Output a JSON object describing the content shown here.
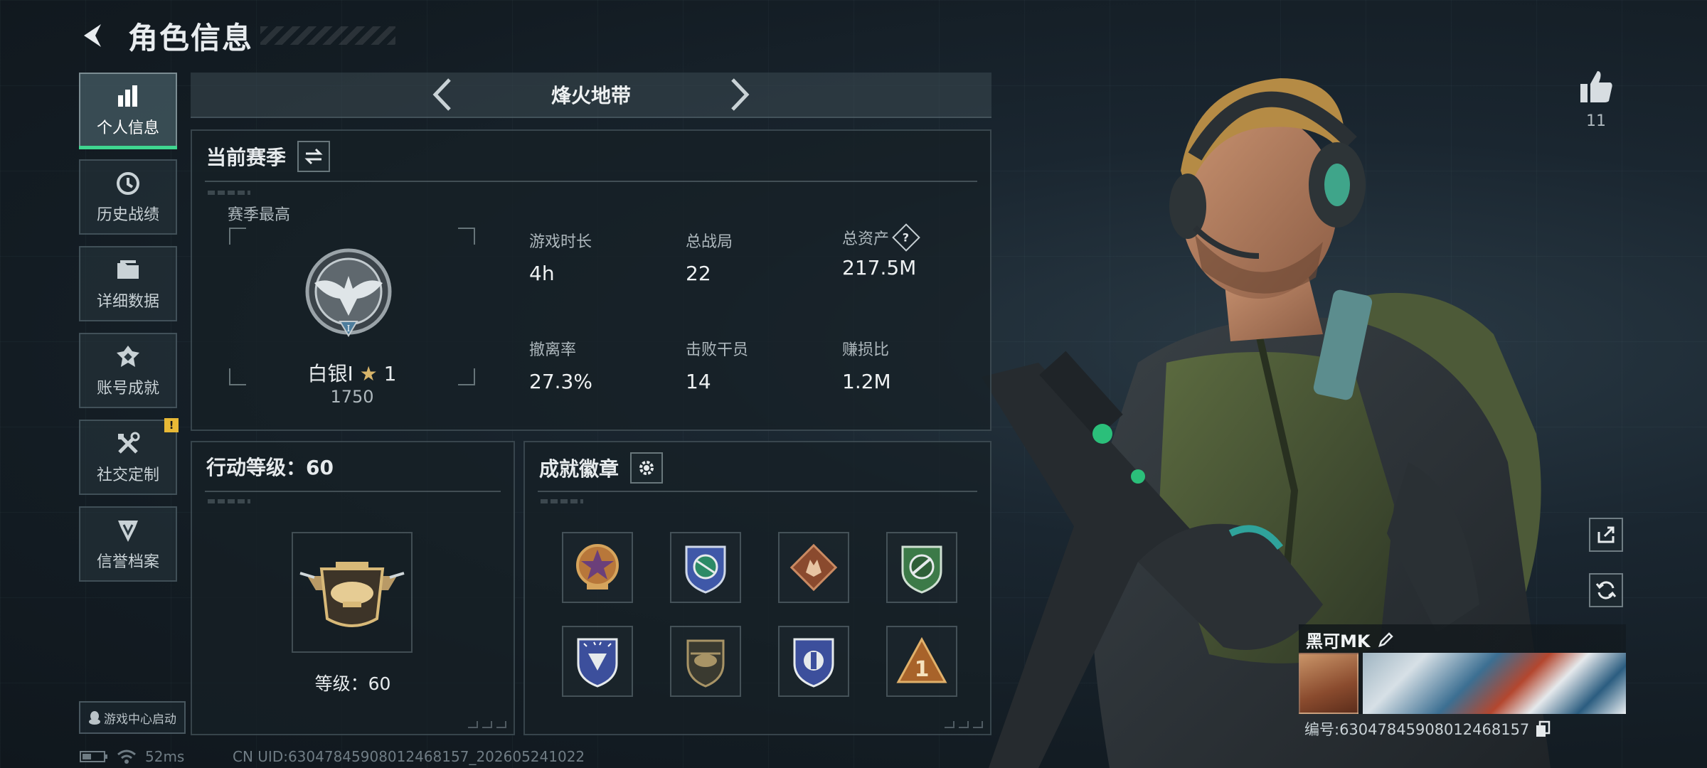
{
  "header": {
    "title": "角色信息"
  },
  "sidebar": {
    "items": [
      {
        "label": "个人信息",
        "icon": "bar-chart-icon",
        "active": true
      },
      {
        "label": "历史战绩",
        "icon": "history-clock-icon"
      },
      {
        "label": "详细数据",
        "icon": "folder-icon"
      },
      {
        "label": "账号成就",
        "icon": "achievement-icon"
      },
      {
        "label": "社交定制",
        "icon": "tools-icon",
        "badge": "!"
      },
      {
        "label": "信誉档案",
        "icon": "reputation-icon"
      }
    ]
  },
  "launch": {
    "label": "游戏中心启动"
  },
  "status": {
    "ping": "52ms",
    "uid": "CN UID:6304784590801246815​7_202605241022"
  },
  "mode": {
    "title": "烽火地带"
  },
  "season": {
    "title": "当前赛季",
    "best_label": "赛季最高",
    "rank": {
      "name": "白银Ⅰ",
      "stars": "1",
      "score": "1750"
    },
    "stats": [
      {
        "label": "游戏时长",
        "value": "4h"
      },
      {
        "label": "总战局",
        "value": "22"
      },
      {
        "label": "总资产",
        "value": "217.5M",
        "help": "?"
      },
      {
        "label": "撤离率",
        "value": "27.3%"
      },
      {
        "label": "击败干员",
        "value": "14"
      },
      {
        "label": "赚损比",
        "value": "1.2M"
      }
    ]
  },
  "level": {
    "title": "行动等级：60",
    "caption": "等级：60"
  },
  "badges": {
    "title": "成就徽章",
    "items": [
      {
        "icon": "star-crest-badge-icon",
        "color": "#b8773a"
      },
      {
        "icon": "blue-compass-badge-icon",
        "color": "#3f58a8"
      },
      {
        "icon": "wolf-diamond-badge-icon",
        "color": "#8a4a2e"
      },
      {
        "icon": "green-rifle-badge-icon",
        "color": "#3c7a48"
      },
      {
        "icon": "blue-shield-badge-icon",
        "color": "#3c4f9c"
      },
      {
        "icon": "helicopter-badge-icon",
        "color": "#8f7a55"
      },
      {
        "icon": "blue-emblem-badge-icon",
        "color": "#3c4f9c"
      },
      {
        "icon": "number-one-triangle-badge-icon",
        "color": "#a8632a"
      }
    ]
  },
  "profile": {
    "likes": "11",
    "name": "黑可MK",
    "id": "编号:6304784590801246815​7"
  },
  "colors": {
    "accent": "#3fd690",
    "warning": "#e8b936"
  }
}
